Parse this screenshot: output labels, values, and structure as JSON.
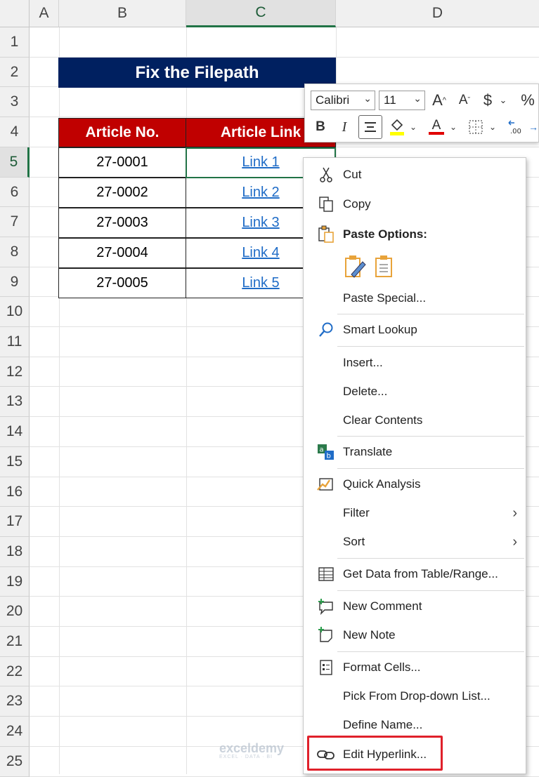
{
  "columns": [
    "A",
    "B",
    "C",
    "D"
  ],
  "rows": [
    "1",
    "2",
    "3",
    "4",
    "5",
    "6",
    "7",
    "8",
    "9",
    "10",
    "11",
    "12",
    "13",
    "14",
    "15",
    "16",
    "17",
    "18",
    "19",
    "20",
    "21",
    "22",
    "23",
    "24",
    "25"
  ],
  "sheet": {
    "title": "Fix the Filepath",
    "headers": [
      "Article No.",
      "Article Link"
    ],
    "table": [
      {
        "no": "27-0001",
        "link": "Link 1"
      },
      {
        "no": "27-0002",
        "link": "Link 2"
      },
      {
        "no": "27-0003",
        "link": "Link 3"
      },
      {
        "no": "27-0004",
        "link": "Link 4"
      },
      {
        "no": "27-0005",
        "link": "Link 5"
      }
    ]
  },
  "mini_toolbar": {
    "font": "Calibri",
    "size": "11",
    "grow": "A",
    "shrink": "A",
    "currency": "$",
    "percent": "%",
    "bold": "B",
    "italic": "I",
    "font_color": "A"
  },
  "menu": {
    "cut": "Cut",
    "copy": "Copy",
    "paste_options": "Paste Options:",
    "paste_special": "Paste Special...",
    "smart_lookup": "Smart Lookup",
    "insert": "Insert...",
    "delete": "Delete...",
    "clear_contents": "Clear Contents",
    "translate": "Translate",
    "quick_analysis": "Quick Analysis",
    "filter": "Filter",
    "sort": "Sort",
    "get_data": "Get Data from Table/Range...",
    "new_comment": "New Comment",
    "new_note": "New Note",
    "format_cells": "Format Cells...",
    "pick_list": "Pick From Drop-down List...",
    "define_name": "Define Name...",
    "edit_hyperlink": "Edit Hyperlink..."
  },
  "watermark": {
    "name": "exceldemy",
    "tagline": "EXCEL · DATA · BI"
  },
  "colors": {
    "title_bg": "#002060",
    "header_bg": "#c00000",
    "link": "#1f6cc7",
    "highlight": "#e0202a",
    "excel_green": "#217346"
  }
}
